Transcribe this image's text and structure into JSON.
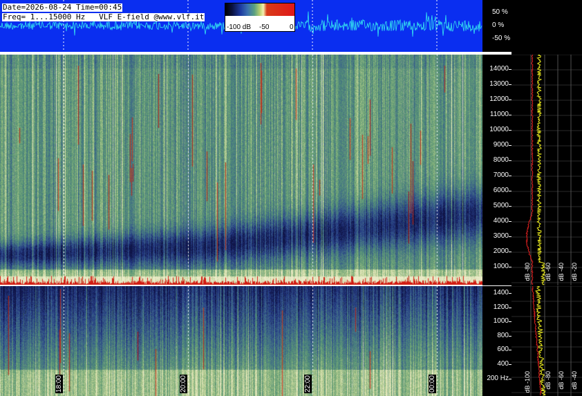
{
  "header": {
    "line1": "Date=2026-08-24 Time=00:45",
    "line2": "Freq= 1...15000 Hz   VLF E-field @www.vlf.it"
  },
  "color_scale": {
    "min_label": "-100 dB",
    "mid_label": "-50",
    "max_label": "0"
  },
  "waveform_axis": {
    "top": "50 %",
    "mid": "0 %",
    "bottom": "-50 %"
  },
  "upper_axis": {
    "ticks": [
      "14000",
      "13000",
      "12000",
      "11000",
      "10000",
      "9000",
      "8000",
      "7000",
      "6000",
      "5000",
      "4000",
      "3000",
      "2000",
      "1000"
    ]
  },
  "lower_axis": {
    "ticks": [
      "1400",
      "1200",
      "1000",
      "800",
      "600",
      "400",
      "200 Hz"
    ]
  },
  "time_labels": [
    "18:00",
    "20:00",
    "22:00",
    "00:00"
  ],
  "profile_upper_labels": [
    "dB -80",
    "dB -60",
    "dB -40",
    "dB -20"
  ],
  "profile_lower_labels": [
    "dB -100",
    "dB -80",
    "dB -60",
    "dB -40"
  ],
  "colors": {
    "waveform_bg": "#0a2ef0",
    "waveform_trace": "#35e8f0",
    "profile_red": "#e02020",
    "profile_yellow": "#f0f020",
    "profile_green": "#30e030"
  }
}
